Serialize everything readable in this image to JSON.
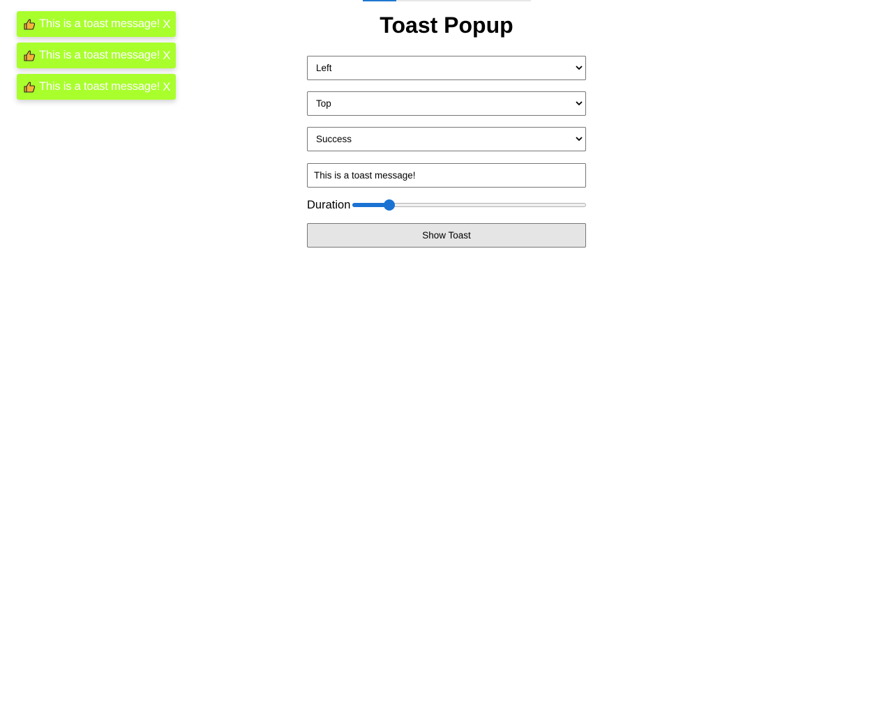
{
  "top_progress": {
    "fraction": 0.2
  },
  "toasts": [
    {
      "message": "This is a toast message!",
      "close_label": "X",
      "icon": "thumbs-up-icon"
    },
    {
      "message": "This is a toast message!",
      "close_label": "X",
      "icon": "thumbs-up-icon"
    },
    {
      "message": "This is a toast message!",
      "close_label": "X",
      "icon": "thumbs-up-icon"
    }
  ],
  "page": {
    "title": "Toast Popup"
  },
  "form": {
    "horizontal_position": {
      "selected": "Left"
    },
    "vertical_position": {
      "selected": "Top"
    },
    "toast_type": {
      "selected": "Success"
    },
    "message_input": {
      "value": "This is a toast message!"
    },
    "duration": {
      "label": "Duration",
      "fraction": 0.14
    },
    "show_button": {
      "label": "Show Toast"
    }
  },
  "colors": {
    "toast_success_bg": "#a9ff2c",
    "slider_accent": "#1a73d3"
  }
}
